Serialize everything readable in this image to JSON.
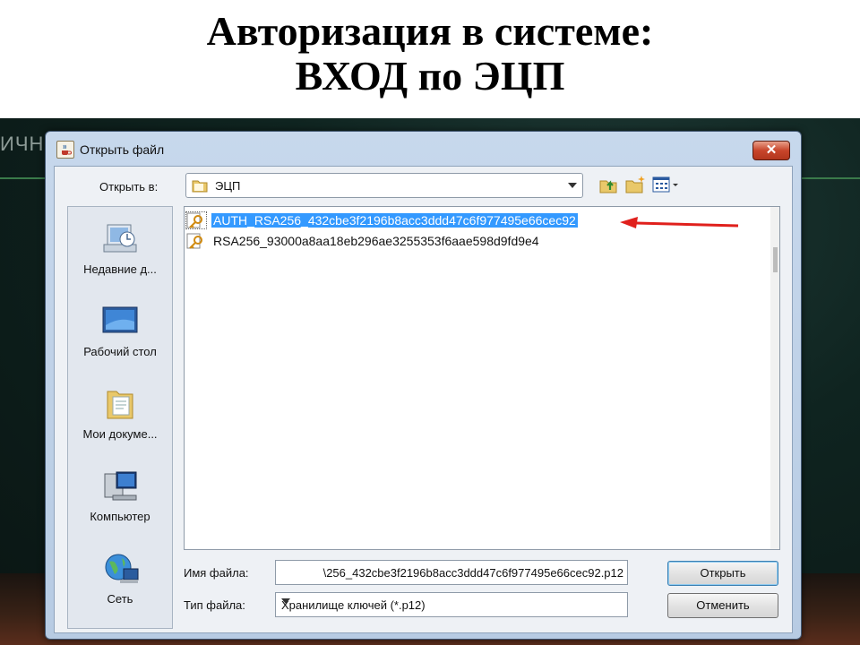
{
  "slide": {
    "title_line1": "Авторизация в системе:",
    "title_line2": "ВХОД по ЭЦП",
    "background_text": "ИЧН"
  },
  "dialog": {
    "title": "Открыть файл",
    "close_label": "✕",
    "look_in": {
      "label": "Открыть в:",
      "value": "ЭЦП"
    },
    "toolbar": {
      "up_icon": "up-folder-icon",
      "new_folder_icon": "new-folder-icon",
      "view_icon": "view-menu-icon"
    },
    "places": [
      {
        "label": "Недавние д...",
        "icon": "recent-documents-icon"
      },
      {
        "label": "Рабочий стол",
        "icon": "desktop-icon"
      },
      {
        "label": "Мои докуме...",
        "icon": "my-documents-icon"
      },
      {
        "label": "Компьютер",
        "icon": "computer-icon"
      },
      {
        "label": "Сеть",
        "icon": "network-icon"
      }
    ],
    "files": [
      {
        "name": "AUTH_RSA256_432cbe3f2196b8acc3ddd47c6f977495e66cec92",
        "selected": true
      },
      {
        "name": "RSA256_93000a8aa18eb296ae3255353f6aae598d9fd9e4",
        "selected": false
      }
    ],
    "filename": {
      "label": "Имя файла:",
      "value": "\\256_432cbe3f2196b8acc3ddd47c6f977495e66cec92.p12"
    },
    "filetype": {
      "label": "Тип файла:",
      "value": "Хранилище ключей (*.p12)"
    },
    "buttons": {
      "open": "Открыть",
      "cancel": "Отменить"
    }
  },
  "colors": {
    "selection": "#3399ff",
    "annotation_arrow": "#e0201c",
    "close_button": "#c8452b"
  }
}
